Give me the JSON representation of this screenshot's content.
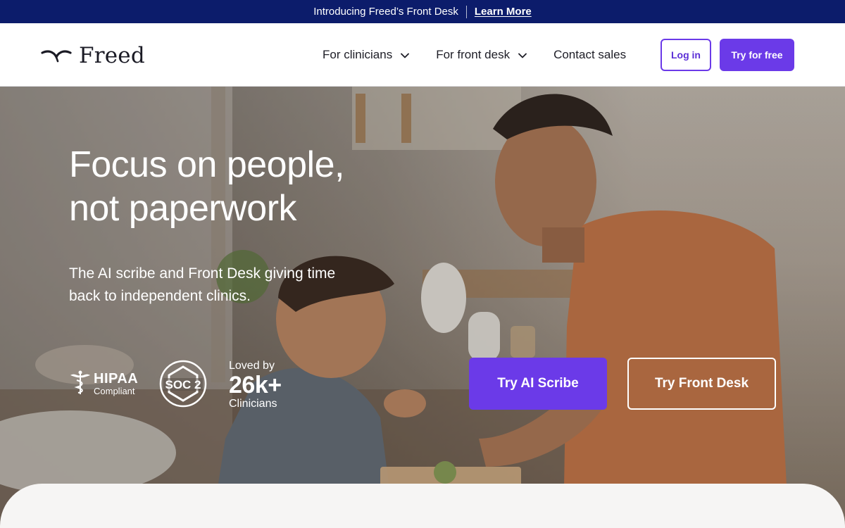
{
  "announcement": {
    "text": "Introducing Freed’s Front Desk",
    "link": "Learn More"
  },
  "header": {
    "logo_text": "Freed",
    "nav": [
      {
        "label": "For clinicians",
        "icon": "chevron-down-icon"
      },
      {
        "label": "For front desk",
        "icon": "chevron-down-icon"
      },
      {
        "label": "Contact sales"
      }
    ],
    "login_label": "Log in",
    "try_label": "Try for free"
  },
  "hero": {
    "title_line1": "Focus on people,",
    "title_line2": "not paperwork",
    "subtitle": "The AI scribe and Front Desk giving time back to independent clinics.",
    "hipaa": {
      "big": "HIPAA",
      "small": "Compliant",
      "icon": "caduceus-icon"
    },
    "soc": {
      "label": "SOC 2",
      "icon": "soc2-badge-icon"
    },
    "loved": {
      "line1": "Loved by",
      "line2": "26k+",
      "line3": "Clinicians"
    },
    "cta_primary": "Try AI Scribe",
    "cta_secondary": "Try Front Desk"
  },
  "colors": {
    "navy": "#0c1c6b",
    "accent": "#6b3ae8",
    "text_dark": "#1d1d26"
  }
}
